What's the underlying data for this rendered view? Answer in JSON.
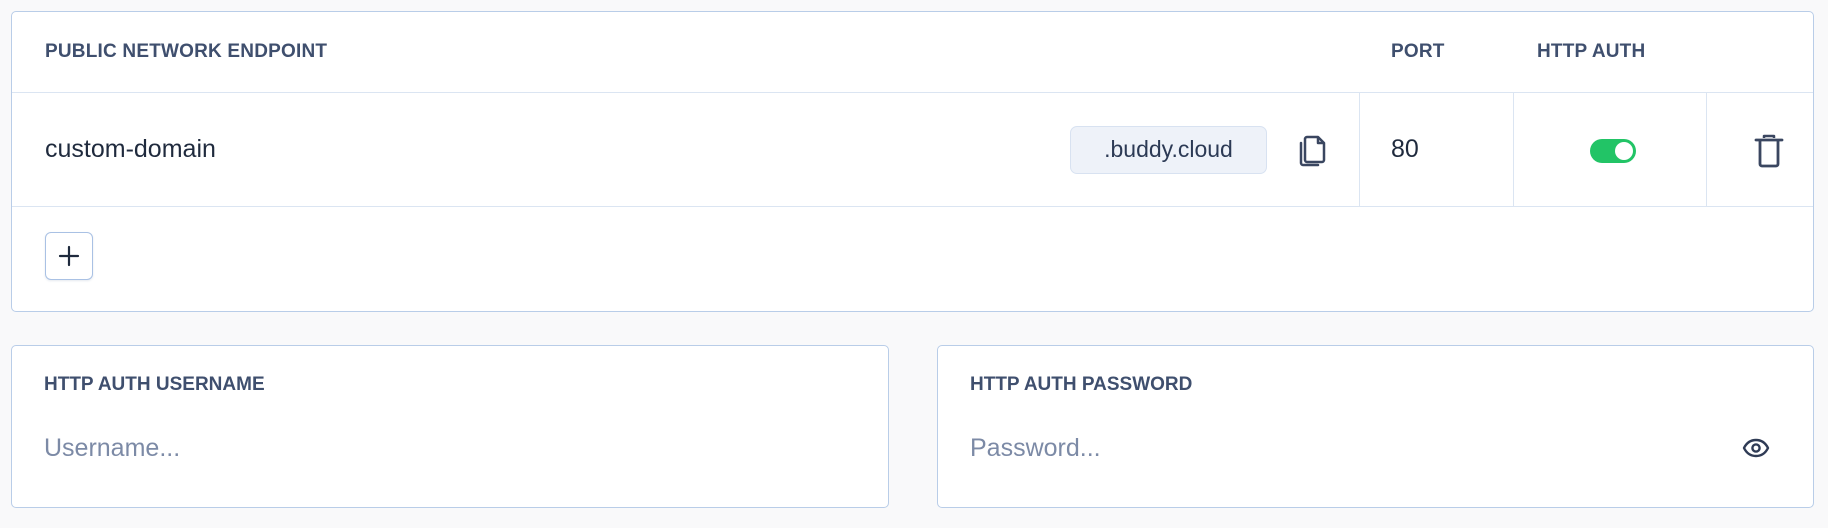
{
  "endpoints_table": {
    "headers": {
      "endpoint": "PUBLIC NETWORK ENDPOINT",
      "port": "PORT",
      "http_auth": "HTTP AUTH"
    },
    "rows": [
      {
        "subdomain": "custom-domain",
        "domain_suffix": ".buddy.cloud",
        "port": "80",
        "http_auth_enabled": true
      }
    ]
  },
  "auth_fields": {
    "username": {
      "label": "HTTP AUTH USERNAME",
      "value": "",
      "placeholder": "Username..."
    },
    "password": {
      "label": "HTTP AUTH PASSWORD",
      "value": "",
      "placeholder": "Password..."
    }
  },
  "icons": {
    "copy": "copy-icon",
    "delete": "trash-icon",
    "add": "plus-icon",
    "reveal": "eye-icon"
  },
  "colors": {
    "toggle_on": "#22c466",
    "panel_border": "#b9cde8",
    "header_text": "#3f4f6e"
  }
}
